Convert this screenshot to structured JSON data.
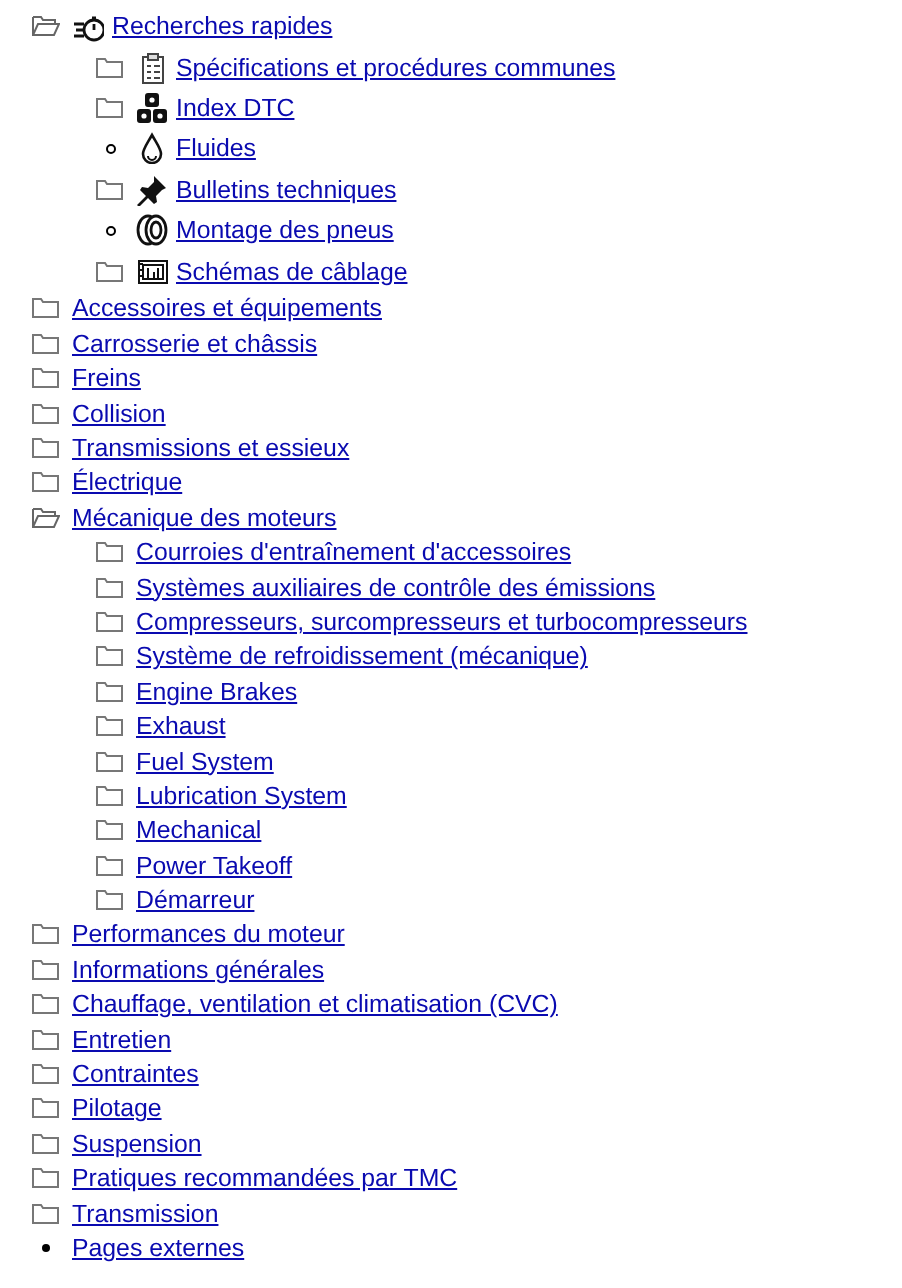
{
  "tree": {
    "items": [
      {
        "label": "Recherches rapides",
        "kind": "folder",
        "expanded": true,
        "children": [
          {
            "label": "Spécifications et procédures communes",
            "kind": "folder",
            "expanded": false
          },
          {
            "label": "Index DTC",
            "kind": "folder",
            "expanded": false
          },
          {
            "label": "Fluides",
            "kind": "leaf"
          },
          {
            "label": "Bulletins techniques",
            "kind": "folder",
            "expanded": false
          },
          {
            "label": "Montage des pneus",
            "kind": "leaf"
          },
          {
            "label": "Schémas de câblage",
            "kind": "folder",
            "expanded": false
          }
        ]
      },
      {
        "label": "Accessoires et équipements",
        "kind": "folder",
        "expanded": false
      },
      {
        "label": "Carrosserie et châssis",
        "kind": "folder",
        "expanded": false
      },
      {
        "label": "Freins",
        "kind": "folder",
        "expanded": false
      },
      {
        "label": "Collision",
        "kind": "folder",
        "expanded": false
      },
      {
        "label": "Transmissions et essieux",
        "kind": "folder",
        "expanded": false
      },
      {
        "label": "Électrique",
        "kind": "folder",
        "expanded": false
      },
      {
        "label": "Mécanique des moteurs",
        "kind": "folder",
        "expanded": true,
        "children": [
          {
            "label": "Courroies d'entraînement d'accessoires",
            "kind": "folder",
            "expanded": false
          },
          {
            "label": "Systèmes auxiliaires de contrôle des émissions",
            "kind": "folder",
            "expanded": false
          },
          {
            "label": "Compresseurs, surcompresseurs et turbocompresseurs",
            "kind": "folder",
            "expanded": false
          },
          {
            "label": "Système de refroidissement (mécanique)",
            "kind": "folder",
            "expanded": false
          },
          {
            "label": "Engine Brakes",
            "kind": "folder",
            "expanded": false
          },
          {
            "label": "Exhaust",
            "kind": "folder",
            "expanded": false
          },
          {
            "label": "Fuel System",
            "kind": "folder",
            "expanded": false
          },
          {
            "label": "Lubrication System",
            "kind": "folder",
            "expanded": false
          },
          {
            "label": "Mechanical",
            "kind": "folder",
            "expanded": false
          },
          {
            "label": "Power Takeoff",
            "kind": "folder",
            "expanded": false
          },
          {
            "label": "Démarreur",
            "kind": "folder",
            "expanded": false
          }
        ]
      },
      {
        "label": "Performances du moteur",
        "kind": "folder",
        "expanded": false
      },
      {
        "label": "Informations générales",
        "kind": "folder",
        "expanded": false
      },
      {
        "label": "Chauffage, ventilation et climatisation (CVC)",
        "kind": "folder",
        "expanded": false
      },
      {
        "label": "Entretien",
        "kind": "folder",
        "expanded": false
      },
      {
        "label": "Contraintes",
        "kind": "folder",
        "expanded": false
      },
      {
        "label": "Pilotage",
        "kind": "folder",
        "expanded": false
      },
      {
        "label": "Suspension",
        "kind": "folder",
        "expanded": false
      },
      {
        "label": "Pratiques recommandées par TMC",
        "kind": "folder",
        "expanded": false
      },
      {
        "label": "Transmission",
        "kind": "folder",
        "expanded": false
      },
      {
        "label": "Pages externes",
        "kind": "leaf"
      }
    ]
  }
}
